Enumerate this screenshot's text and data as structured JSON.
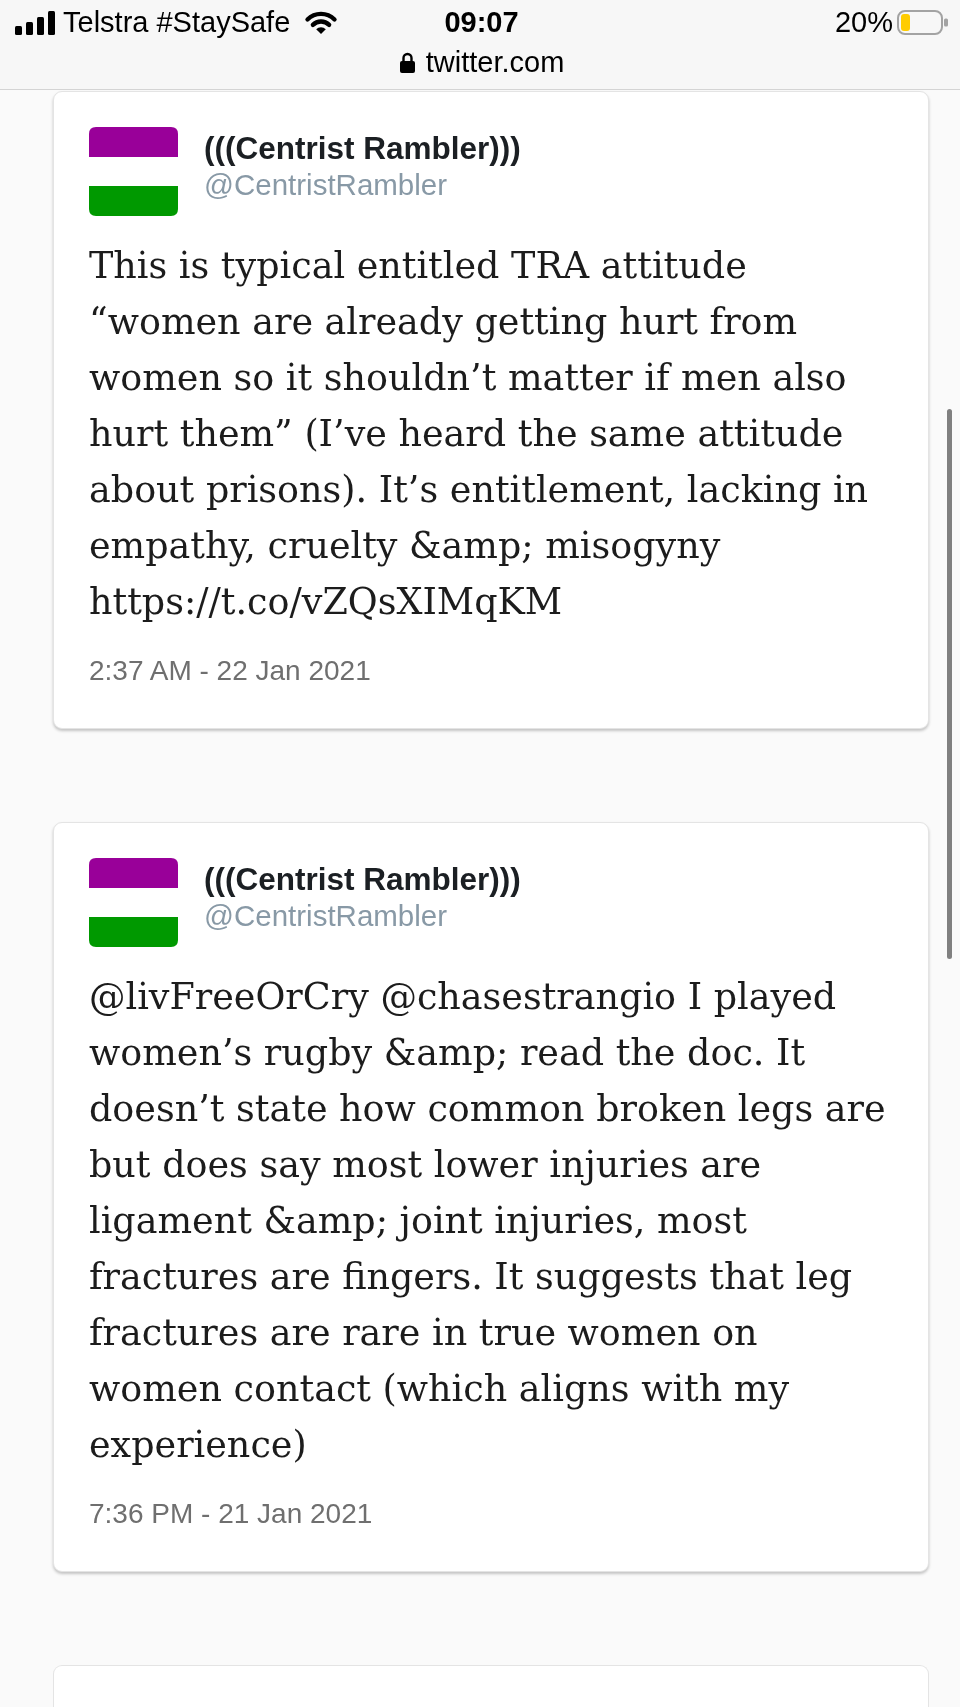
{
  "status_bar": {
    "carrier": "Telstra #StaySafe",
    "time": "09:07",
    "battery": "20%"
  },
  "address_bar": {
    "url": "twitter.com",
    "secure": true
  },
  "tweets": [
    {
      "name": "(((Centrist Rambler)))",
      "handle": "@CentristRambler",
      "text": "This is typical entitled TRA attitude “women are already getting hurt from women so it shouldn’t matter if men also hurt them” (I’ve heard the same attitude about prisons). It’s entitlement, lacking in empathy, cruelty &amp; misogyny https://t.co/vZQsXIMqKM",
      "timestamp": "2:37 AM - 22 Jan 2021"
    },
    {
      "name": "(((Centrist Rambler)))",
      "handle": "@CentristRambler",
      "text": "@livFreeOrCry @chasestrangio I played women’s rugby &amp; read the doc. It doesn’t state how common broken legs are but does say most lower injuries are ligament &amp; joint injuries, most fractures are fingers. It suggests that leg fractures are rare in true women on women contact (which aligns with my experience)",
      "timestamp": "7:36 PM - 21 Jan 2021"
    }
  ],
  "partial_card_below": true
}
